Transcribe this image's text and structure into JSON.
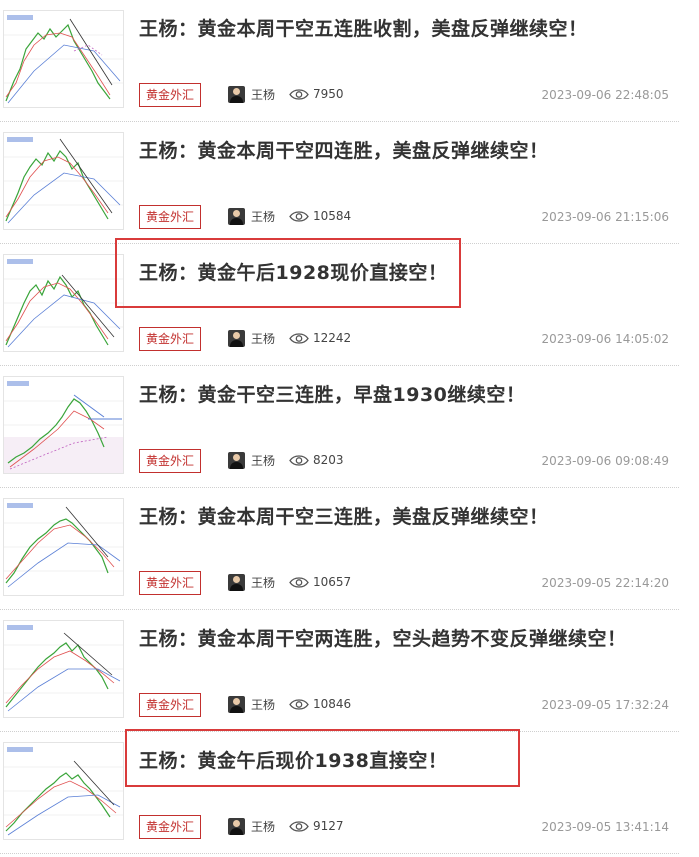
{
  "articles": [
    {
      "title": "王杨：黄金本周干空五连胜收割，美盘反弹继续空！",
      "tag": "黄金外汇",
      "author": "王杨",
      "views": "7950",
      "date": "2023-09-06 22:48:05"
    },
    {
      "title": "王杨：黄金本周干空四连胜，美盘反弹继续空！",
      "tag": "黄金外汇",
      "author": "王杨",
      "views": "10584",
      "date": "2023-09-06 21:15:06"
    },
    {
      "title": "王杨：黄金午后1928现价直接空！",
      "tag": "黄金外汇",
      "author": "王杨",
      "views": "12242",
      "date": "2023-09-06 14:05:02"
    },
    {
      "title": "王杨：黄金干空三连胜，早盘1930继续空！",
      "tag": "黄金外汇",
      "author": "王杨",
      "views": "8203",
      "date": "2023-09-06 09:08:49"
    },
    {
      "title": "王杨：黄金本周干空三连胜，美盘反弹继续空！",
      "tag": "黄金外汇",
      "author": "王杨",
      "views": "10657",
      "date": "2023-09-05 22:14:20"
    },
    {
      "title": "王杨：黄金本周干空两连胜，空头趋势不变反弹继续空！",
      "tag": "黄金外汇",
      "author": "王杨",
      "views": "10846",
      "date": "2023-09-05 17:32:24"
    },
    {
      "title": "王杨：黄金午后现价1938直接空！",
      "tag": "黄金外汇",
      "author": "王杨",
      "views": "9127",
      "date": "2023-09-05 13:41:14"
    }
  ],
  "colors": {
    "tag": "#c2302e",
    "highlight": "#d93b3b"
  }
}
